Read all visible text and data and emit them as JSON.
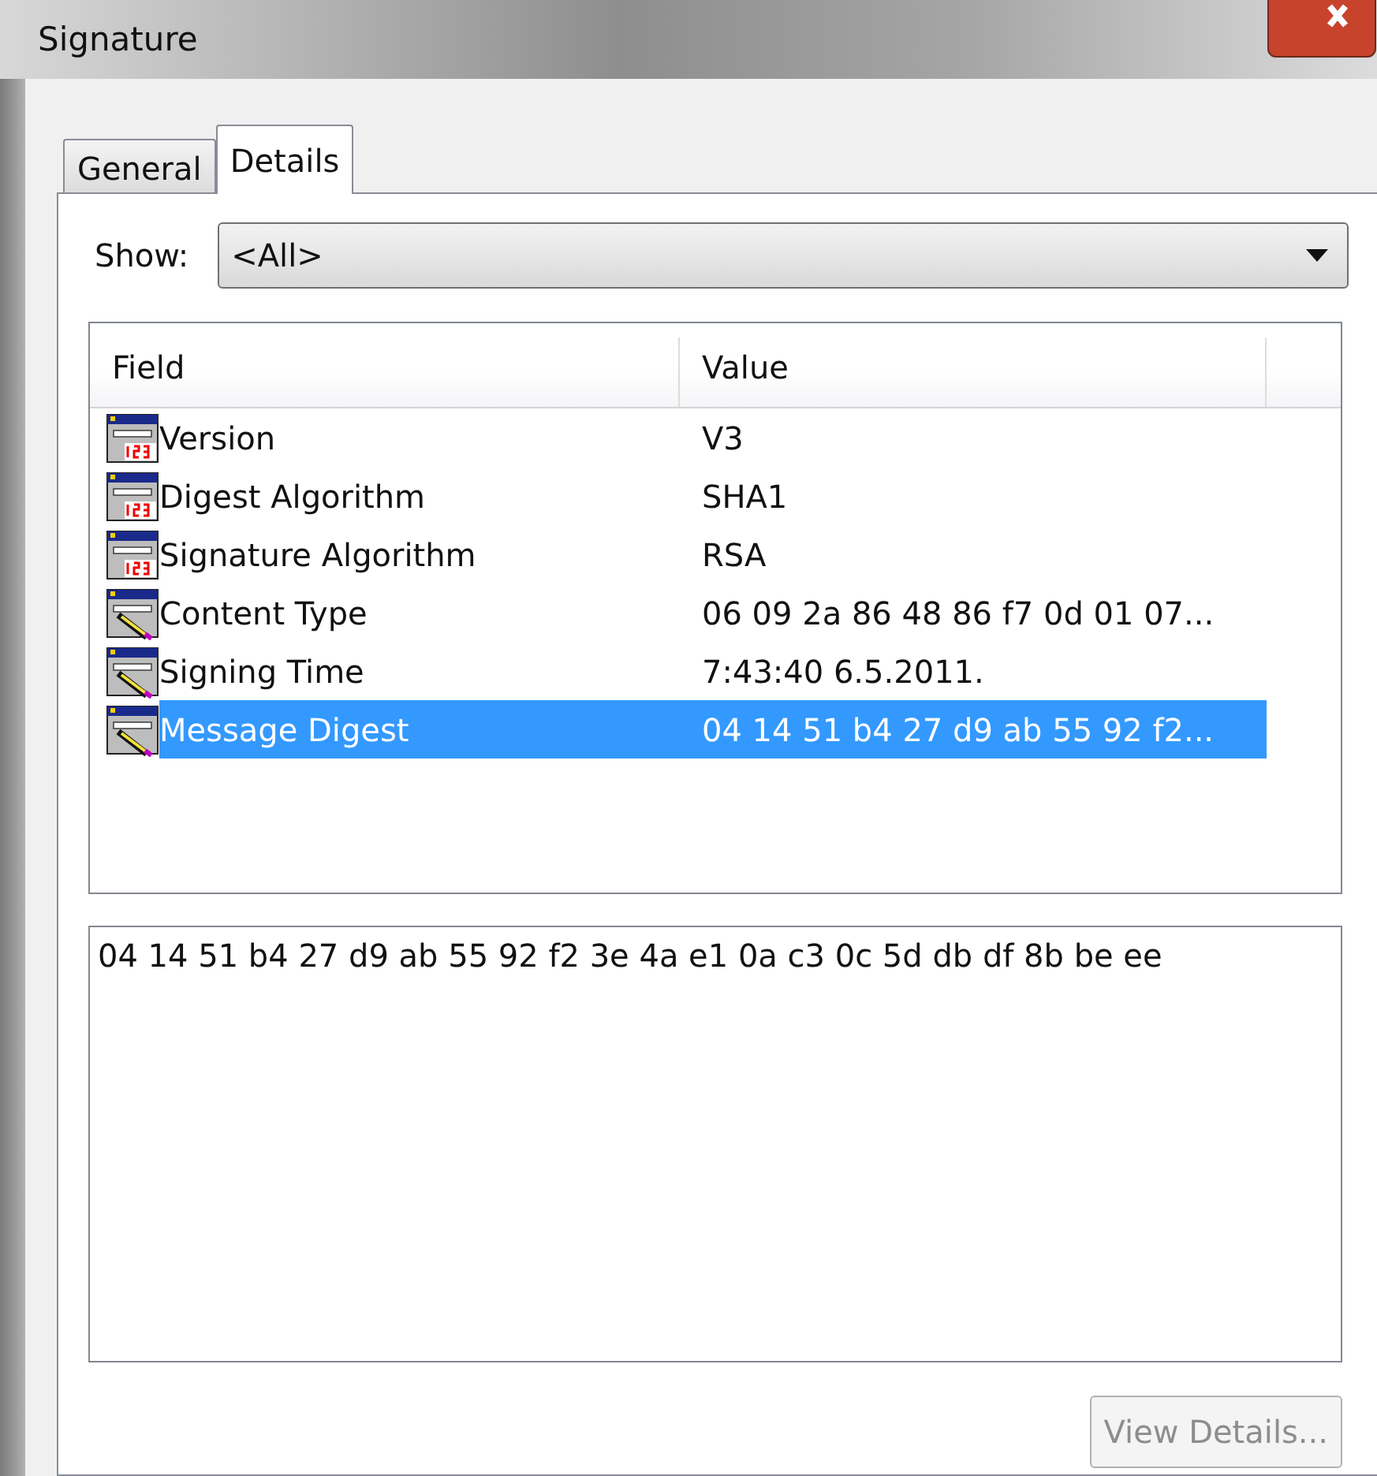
{
  "window": {
    "title": "Signature"
  },
  "tabs": [
    {
      "label": "General",
      "selected": false
    },
    {
      "label": "Details",
      "selected": true
    }
  ],
  "show": {
    "label": "Show:",
    "value": "<All>"
  },
  "table": {
    "columns": [
      "Field",
      "Value"
    ],
    "rows": [
      {
        "kind": "number",
        "field": "Version",
        "value": "V3",
        "selected": false
      },
      {
        "kind": "number",
        "field": "Digest Algorithm",
        "value": "SHA1",
        "selected": false
      },
      {
        "kind": "number",
        "field": "Signature Algorithm",
        "value": "RSA",
        "selected": false
      },
      {
        "kind": "pencil",
        "field": "Content Type",
        "value": "06 09 2a 86 48 86 f7 0d 01 07...",
        "selected": false
      },
      {
        "kind": "pencil",
        "field": "Signing Time",
        "value": "7:43:40 6.5.2011.",
        "selected": false
      },
      {
        "kind": "pencil",
        "field": "Message Digest",
        "value": "04 14 51 b4 27 d9 ab 55 92 f2...",
        "selected": true
      }
    ]
  },
  "detail": {
    "value": "04 14 51 b4 27 d9 ab 55 92 f2 3e 4a e1 0a c3 0c 5d db df 8b be ee"
  },
  "buttons": [
    {
      "label": "View Details...",
      "disabled": true
    }
  ]
}
